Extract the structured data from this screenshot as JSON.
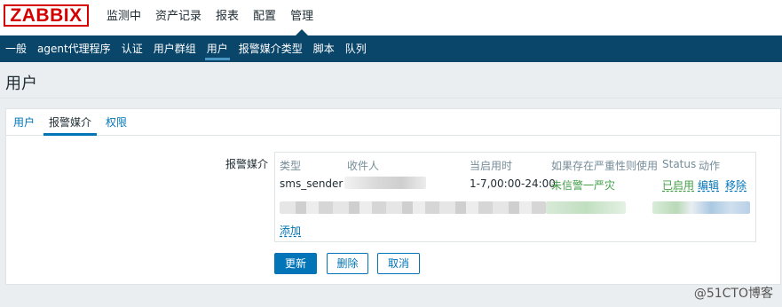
{
  "logo": {
    "text": "ZABBIX"
  },
  "top_nav": [
    "监测中",
    "资产记录",
    "报表",
    "配置",
    "管理"
  ],
  "sub_nav": [
    "一般",
    "agent代理程序",
    "认证",
    "用户群组",
    "用户",
    "报警媒介类型",
    "脚本",
    "队列"
  ],
  "page": {
    "title": "用户"
  },
  "tabs": [
    "用户",
    "报警媒介",
    "权限"
  ],
  "form": {
    "label": "报警媒介"
  },
  "media_table": {
    "headers": [
      "类型",
      "收件人",
      "当启用时",
      "如果存在严重性则使用",
      "Status",
      "动作"
    ],
    "rows": [
      {
        "type": "sms_sender",
        "recipient": "",
        "when_active": "1-7,00:00-24:00",
        "severity": "未信警一严灾",
        "status": "已启用",
        "edit": "编辑",
        "remove": "移除"
      }
    ],
    "add_link": "添加"
  },
  "buttons": {
    "update": "更新",
    "delete": "删除",
    "cancel": "取消"
  },
  "watermark": "@51CTO博客",
  "colors": {
    "brand_red": "#d40000",
    "nav_dark": "#0a466a",
    "link_blue": "#0275b8",
    "status_green": "#429e47"
  }
}
